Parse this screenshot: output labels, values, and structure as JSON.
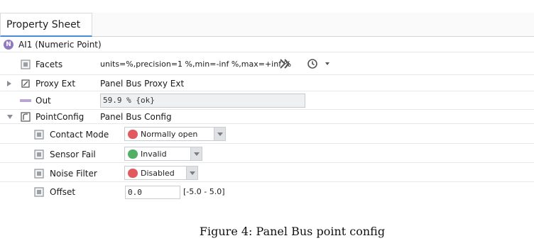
{
  "tab": {
    "label": "Property Sheet"
  },
  "header": {
    "badge": "N",
    "title": "AI1  (Numeric Point)"
  },
  "rows": {
    "facets": {
      "label": "Facets",
      "value": "units=%,precision=1 %,min=-inf %,max=+inf %"
    },
    "proxy_ext": {
      "label": "Proxy Ext",
      "value": "Panel Bus Proxy Ext"
    },
    "out": {
      "label": "Out",
      "value": "59.9 % {ok}"
    },
    "point_config": {
      "label": "PointConfig",
      "value": "Panel Bus Config"
    },
    "contact_mode": {
      "label": "Contact Mode",
      "value": "Normally open",
      "status_color": "#e05a5e"
    },
    "sensor_fail": {
      "label": "Sensor Fail",
      "value": "Invalid",
      "status_color": "#4fb063"
    },
    "noise_filter": {
      "label": "Noise Filter",
      "value": "Disabled",
      "status_color": "#e05a5e"
    },
    "offset": {
      "label": "Offset",
      "value": "0.0",
      "range": "[-5.0 - 5.0]"
    }
  },
  "caption": "Figure 4: Panel Bus point config",
  "colors": {
    "tab_accent": "#4a8dd6",
    "badge": "#8f7ac2",
    "out_slot": "#b9a6d4"
  }
}
